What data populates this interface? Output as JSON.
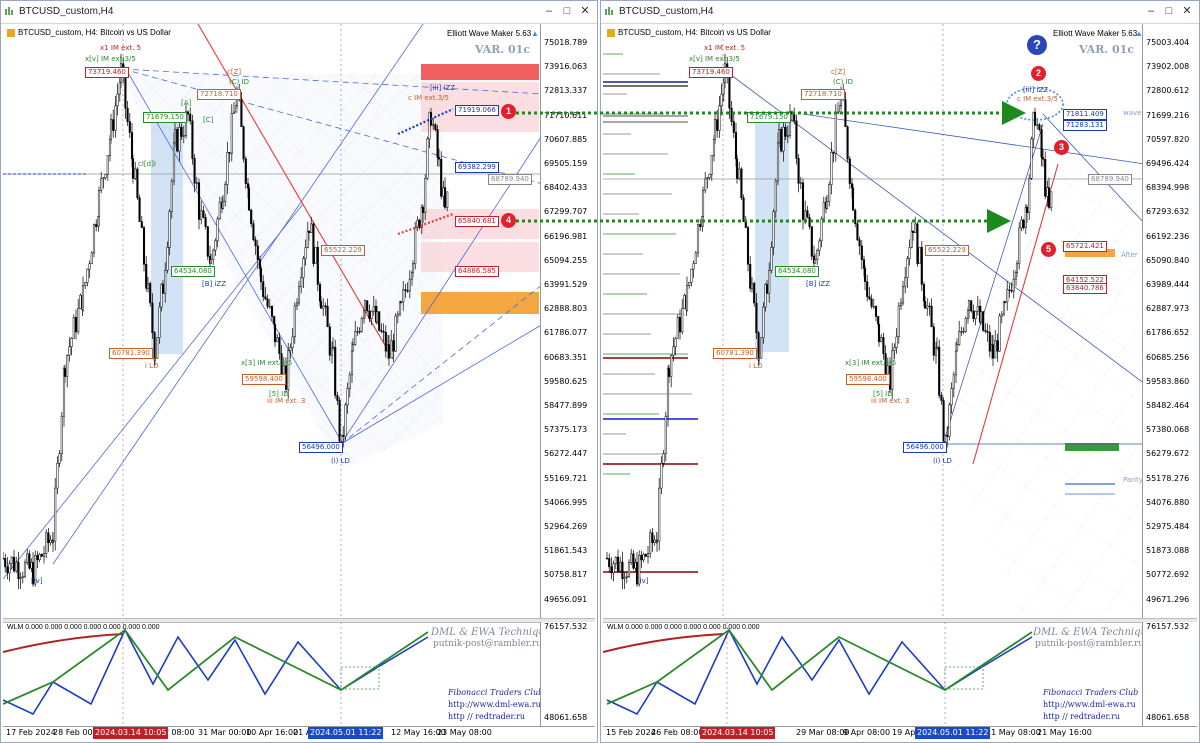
{
  "left": {
    "window_title": "BTCUSD_custom,H4",
    "chart_header": "BTCUSD_custom, H4:  Bitcoin vs US Dollar",
    "em_title": "Elliott Wave Maker 5.63",
    "var_label": "VAR. 01c",
    "price_ticks": [
      "75018.789",
      "73916.063",
      "72813.337",
      "71710.611",
      "70607.885",
      "69505.159",
      "68402.433",
      "67299.707",
      "66196.981",
      "65094.255",
      "63991.529",
      "62888.803",
      "61786.077",
      "60683.351",
      "59580.625",
      "58477.899",
      "57375.173",
      "56272.447",
      "55169.721",
      "54066.995",
      "52964.269",
      "51861.543",
      "50758.817",
      "49656.091"
    ],
    "sub_ticks": [
      "76157.532",
      "48061.658"
    ],
    "time_ticks": [
      "17 Feb 2024",
      "28 Feb 00:00",
      "10 Mar 08:00",
      "31 Mar 00:00",
      "10 Apr 16:00",
      "21 Apr",
      "12 May 16:00",
      "23 May 08:00"
    ],
    "time_highlights": [
      "2024.03.14 10:05",
      "2024.05.01 11:22"
    ],
    "price_boxes": [
      "73719.460",
      "72718.710",
      "71679.150",
      "71919.066",
      "69382.299",
      "68789.940",
      "65840.681",
      "65522.229",
      "64886.585",
      "64534.080",
      "60781.390",
      "59598.400",
      "56496.000"
    ],
    "wave_labels": [
      "x1 IM ext. 5",
      "x[v] IM ext.3/5",
      "c[Z]",
      "(C) ID",
      "[iii] iZZ",
      "c IM ext.3/5",
      "cI[d]I",
      "[B] iZZ",
      "[iv]",
      "(i) LD",
      "i LD",
      "x[3] IM ext.3/5",
      "[5] ID",
      "iii IM ext. 3",
      "[A]",
      "[C]"
    ],
    "circles": [
      "1",
      "4"
    ],
    "sub_label": "WLM 0.000 0.000 0.000 0.000 0.000 0.000 0.000",
    "dml": "DML & EWA Technique",
    "email": "putnik-post@rambler.ru",
    "fib_club": "Fibonacci  Traders  Club",
    "url1": "http://www.dml-ewa.ru",
    "url2": "http // redtrader.ru"
  },
  "right": {
    "window_title": "BTCUSD_custom,H4",
    "chart_header": "BTCUSD_custom, H4:  Bitcoin vs US Dollar",
    "em_title": "Elliott Wave Maker 5.63",
    "var_label": "VAR. 01c",
    "price_ticks": [
      "75003.404",
      "73902.008",
      "72800.612",
      "71699.216",
      "70597.820",
      "69496.424",
      "68394.998",
      "67293.632",
      "66192.236",
      "65090.840",
      "63989.444",
      "62887.973",
      "61786.652",
      "60685.256",
      "59583.860",
      "58482.464",
      "57380.068",
      "56279.672",
      "55178.276",
      "54076.880",
      "52975.484",
      "51873.088",
      "50772.692",
      "49671.296"
    ],
    "sub_ticks": [
      "76157.532",
      "48061.658"
    ],
    "time_ticks": [
      "15 Feb 2024",
      "26 Feb 08:00",
      "29 Mar 08:00",
      "9 Apr 08:00",
      "19 Apr",
      "11 May 08:00",
      "21 May 16:00"
    ],
    "time_highlights": [
      "2024.03.14 10:05",
      "2024.05.01 11:22"
    ],
    "price_boxes": [
      "73719.460",
      "72718.710",
      "71679.150",
      "71811.409",
      "71283.131",
      "68789.940",
      "65522.229",
      "65721.421",
      "64152.522",
      "63840.786",
      "64534.080",
      "60781.390",
      "59598.400",
      "56496.000"
    ],
    "wave_labels": [
      "x1 IM ext. 5",
      "x[v] IM ext.3/5",
      "c[Z]",
      "(C) ID",
      "[iii] iZZ",
      "c IM ext.3/5",
      "[B] iZZ",
      "[iv]",
      "(i) LD",
      "i LD",
      "x[3] IM ext.3/5",
      "[5] ID",
      "iii IM ext. 3",
      "wave",
      "After",
      "Parity"
    ],
    "circles": [
      "2",
      "3",
      "5"
    ],
    "sub_label": "WLM 0.000 0.000 0.000 0.000 0.000 0.000 0.000",
    "dml": "DML & EWA Technique",
    "email": "putnik-post@rambler.ru",
    "fib_club": "Fibonacci  Traders  Club",
    "url1": "http://www.dml-ewa.ru",
    "url2": "http // redtrader.ru"
  },
  "colors": {
    "candle": "#000000",
    "trend_red": "#e83a3a",
    "wave_blue": "#1c3cc8",
    "wave_green": "#2a8a2a",
    "arrow_green": "#1e8a1e",
    "zone_red": "#f06060",
    "zone_pink": "#f8d0d4",
    "zone_orange": "#f4a640",
    "zone_blue": "#c8dcf4",
    "highlight_red": "#c0202a",
    "highlight_blue": "#1a4ac8"
  }
}
